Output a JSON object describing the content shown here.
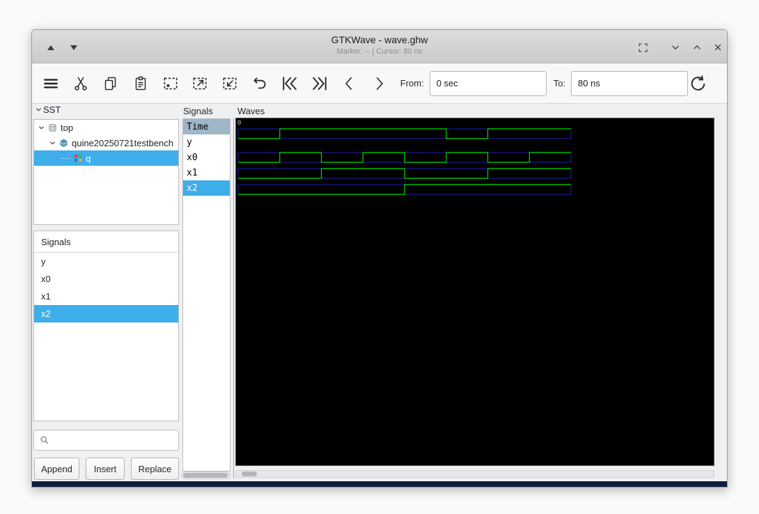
{
  "window": {
    "title": "GTKWave - wave.ghw",
    "status": "Marker: --  |  Cursor: 80 ns"
  },
  "colors": {
    "accent": "#3daee9",
    "wave_background": "#000000",
    "wave_trace": "#00dd00",
    "wave_rail": "#2121ae",
    "time_header_bg": "#9fb6c7"
  },
  "icons": {
    "titlebar_left": [
      "shade-up-icon",
      "shade-down-icon"
    ],
    "titlebar_right": [
      "restore-icon",
      "chevron-down-icon",
      "chevron-up-icon",
      "close-icon"
    ],
    "toolbar": [
      "menu-icon",
      "cut-icon",
      "copy-icon",
      "paste-icon",
      "zoom-fit-icon",
      "zoom-in-icon",
      "zoom-out-icon",
      "undo-icon",
      "skip-start-icon",
      "skip-end-icon",
      "prev-edge-icon",
      "next-edge-icon",
      "reload-icon"
    ],
    "search": "search-icon"
  },
  "toolbar": {
    "from_label": "From:",
    "from_value": "0 sec",
    "to_label": "To:",
    "to_value": "80 ns"
  },
  "sst": {
    "label": "SST",
    "tree": {
      "root": "top",
      "child": "quine20250721testbench",
      "leaf": "q"
    },
    "signals_box": {
      "header": "Signals",
      "items": [
        {
          "label": "y",
          "selected": false
        },
        {
          "label": "x0",
          "selected": false
        },
        {
          "label": "x1",
          "selected": false
        },
        {
          "label": "x2",
          "selected": true
        }
      ]
    },
    "buttons": {
      "append": "Append",
      "insert": "Insert",
      "replace": "Replace"
    }
  },
  "signals_panel": {
    "label": "Signals",
    "time_header": "Time",
    "rows": [
      {
        "name": "y",
        "selected": false
      },
      {
        "name": "x0",
        "selected": false
      },
      {
        "name": "x1",
        "selected": false
      },
      {
        "name": "x2",
        "selected": true
      }
    ]
  },
  "waves_panel": {
    "label": "Waves",
    "origin_time_label": "0"
  },
  "wave_data": {
    "type": "digital-timing",
    "unit": "ns",
    "t_start": 0,
    "t_end": 80,
    "step_ns": 10,
    "colors": {
      "trace": "#00dd00",
      "rail": "#2121ae",
      "background": "#000000"
    },
    "signals": [
      {
        "name": "y",
        "values": [
          0,
          1,
          1,
          1,
          1,
          0,
          1,
          1
        ]
      },
      {
        "name": "x0",
        "values": [
          0,
          1,
          0,
          1,
          0,
          1,
          0,
          1
        ]
      },
      {
        "name": "x1",
        "values": [
          0,
          0,
          1,
          1,
          0,
          0,
          1,
          1
        ]
      },
      {
        "name": "x2",
        "values": [
          0,
          0,
          0,
          0,
          1,
          1,
          1,
          1
        ]
      }
    ]
  }
}
